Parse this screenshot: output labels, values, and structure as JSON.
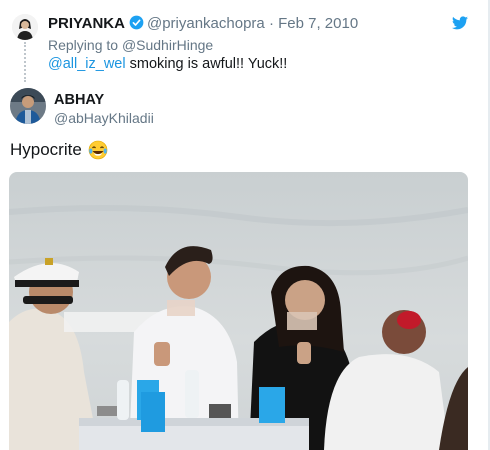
{
  "quoted_tweet": {
    "name": "PRIYANKA",
    "handle": "@priyankachopra",
    "separator": "·",
    "date": "Feb 7, 2010",
    "replying_prefix": "Replying to",
    "replying_to": "@SudhirHinge",
    "mention": "@all_iz_wel",
    "text": "smoking is awful!! Yuck!!",
    "verified_icon": "verified-badge-icon"
  },
  "tweet": {
    "name": "ABHAY",
    "handle": "@abHayKhiladii",
    "text": "Hypocrite",
    "emoji": "tears-of-joy-emoji"
  },
  "brand": {
    "icon": "twitter-bird-icon",
    "color": "#1da1f2"
  },
  "colors": {
    "link": "#1b95e0",
    "muted": "#657786",
    "text": "#14171a"
  }
}
